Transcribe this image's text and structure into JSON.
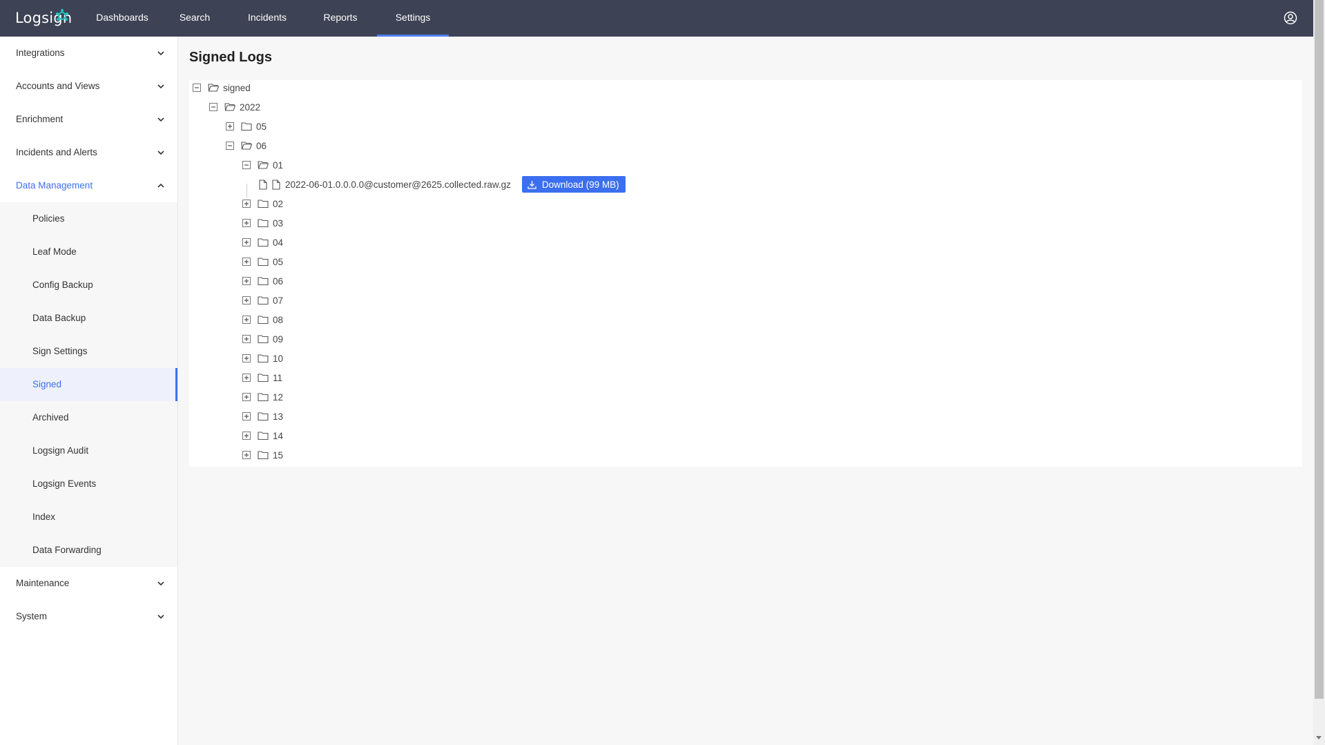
{
  "app": {
    "logo_text": "Logsign"
  },
  "nav": {
    "tabs": [
      {
        "label": "Dashboards"
      },
      {
        "label": "Search"
      },
      {
        "label": "Incidents"
      },
      {
        "label": "Reports"
      },
      {
        "label": "Settings",
        "active": true
      }
    ]
  },
  "sidebar": {
    "groups": [
      {
        "label": "Integrations"
      },
      {
        "label": "Accounts and Views"
      },
      {
        "label": "Enrichment"
      },
      {
        "label": "Incidents and Alerts"
      },
      {
        "label": "Data Management",
        "open": true
      },
      {
        "label": "Maintenance"
      },
      {
        "label": "System"
      }
    ],
    "data_management_items": [
      {
        "label": "Policies"
      },
      {
        "label": "Leaf Mode"
      },
      {
        "label": "Config Backup"
      },
      {
        "label": "Data Backup"
      },
      {
        "label": "Sign Settings"
      },
      {
        "label": "Signed",
        "active": true
      },
      {
        "label": "Archived"
      },
      {
        "label": "Logsign Audit"
      },
      {
        "label": "Logsign Events"
      },
      {
        "label": "Index"
      },
      {
        "label": "Data Forwarding"
      }
    ]
  },
  "main": {
    "title": "Signed Logs",
    "tree": {
      "root": "signed",
      "year": "2022",
      "months": [
        "05",
        "06"
      ],
      "days": [
        "01",
        "02",
        "03",
        "04",
        "05",
        "06",
        "07",
        "08",
        "09",
        "10",
        "11",
        "12",
        "13",
        "14",
        "15"
      ],
      "file": {
        "name": "2022-06-01.0.0.0.0@customer@2625.collected.raw.gz",
        "download_label": "Download (99 MB)"
      }
    }
  },
  "colors": {
    "topbar": "#3d4354",
    "accent": "#3c6ff0"
  },
  "icons": {
    "user": "user-circle-icon",
    "chevron": "chevron-down-icon",
    "folder": "folder-icon",
    "file": "file-icon"
  }
}
